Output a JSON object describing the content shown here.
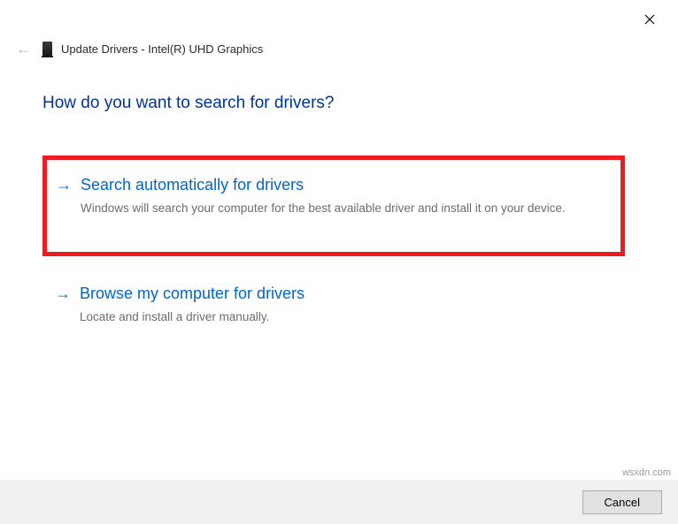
{
  "window": {
    "title": "Update Drivers - Intel(R) UHD Graphics"
  },
  "heading": "How do you want to search for drivers?",
  "options": [
    {
      "title": "Search automatically for drivers",
      "description": "Windows will search your computer for the best available driver and install it on your device."
    },
    {
      "title": "Browse my computer for drivers",
      "description": "Locate and install a driver manually."
    }
  ],
  "buttons": {
    "cancel": "Cancel"
  },
  "watermark": "wsxdn.com"
}
